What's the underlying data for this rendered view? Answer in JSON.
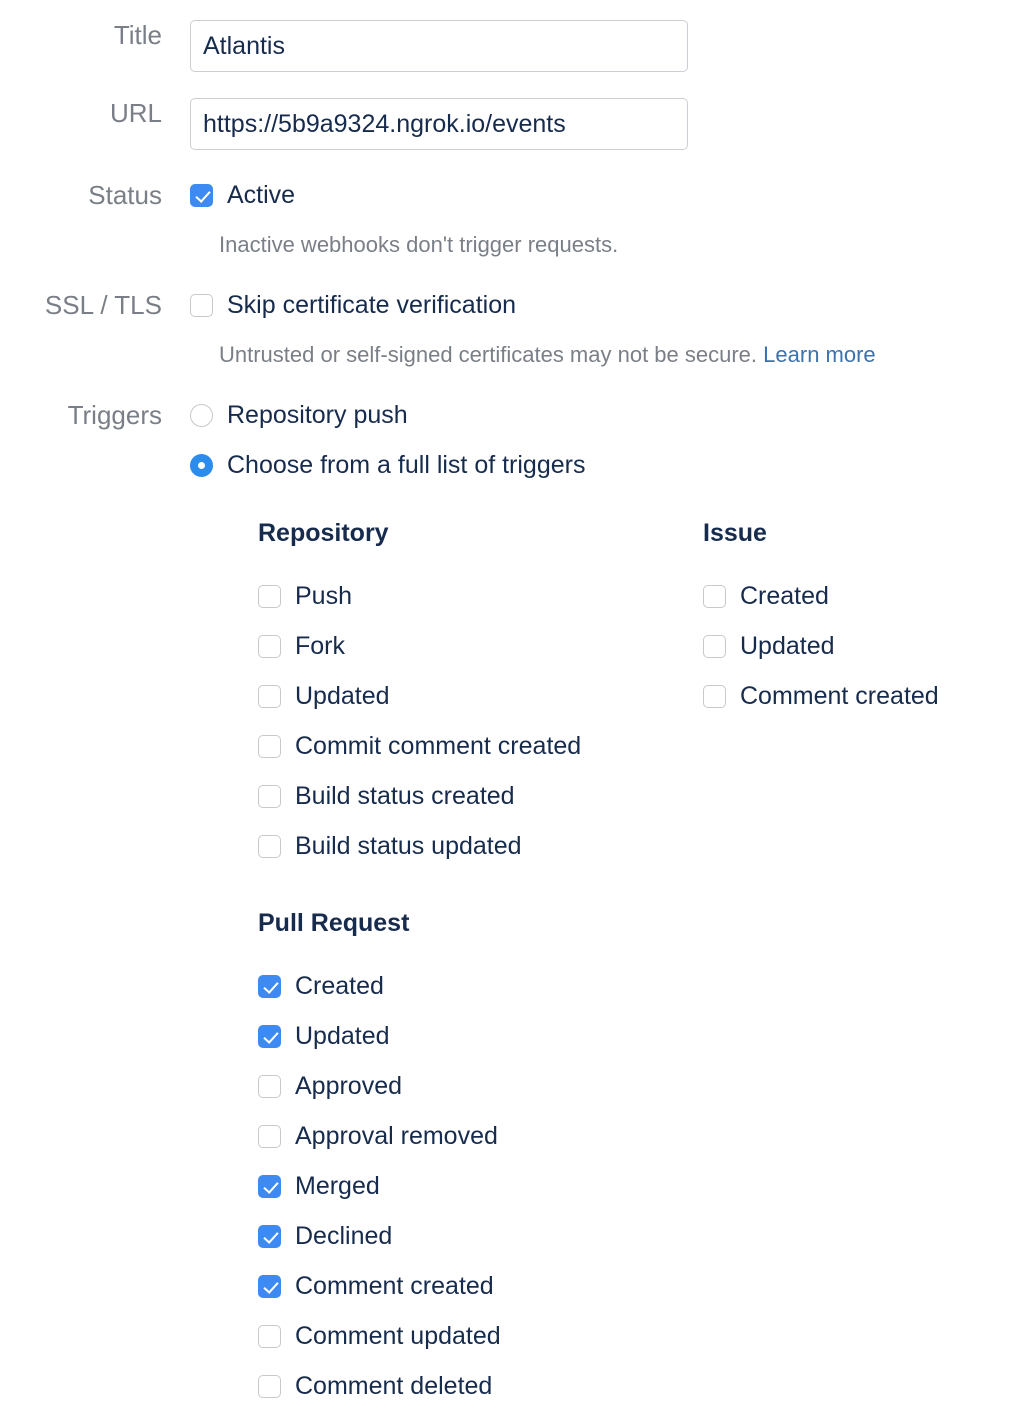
{
  "form": {
    "title": {
      "label": "Title",
      "value": "Atlantis",
      "placeholder": "Title"
    },
    "url": {
      "label": "URL",
      "value": "https://5b9a9324.ngrok.io/events",
      "placeholder": "URL"
    },
    "status": {
      "label": "Status",
      "active_label": "Active",
      "active_checked": true,
      "helper": "Inactive webhooks don't trigger requests."
    },
    "ssl": {
      "label": "SSL / TLS",
      "skip_label": "Skip certificate verification",
      "skip_checked": false,
      "helper": "Untrusted or self-signed certificates may not be secure.",
      "link_label": "Learn more"
    },
    "triggers": {
      "label": "Triggers",
      "options": [
        {
          "label": "Repository push",
          "selected": false
        },
        {
          "label": "Choose from a full list of triggers",
          "selected": true
        }
      ]
    }
  },
  "trigger_groups": {
    "repository": {
      "heading": "Repository",
      "items": [
        {
          "label": "Push",
          "checked": false
        },
        {
          "label": "Fork",
          "checked": false
        },
        {
          "label": "Updated",
          "checked": false
        },
        {
          "label": "Commit comment created",
          "checked": false
        },
        {
          "label": "Build status created",
          "checked": false
        },
        {
          "label": "Build status updated",
          "checked": false
        }
      ]
    },
    "issue": {
      "heading": "Issue",
      "items": [
        {
          "label": "Created",
          "checked": false
        },
        {
          "label": "Updated",
          "checked": false
        },
        {
          "label": "Comment created",
          "checked": false
        }
      ]
    },
    "pull_request": {
      "heading": "Pull Request",
      "items": [
        {
          "label": "Created",
          "checked": true
        },
        {
          "label": "Updated",
          "checked": true
        },
        {
          "label": "Approved",
          "checked": false
        },
        {
          "label": "Approval removed",
          "checked": false
        },
        {
          "label": "Merged",
          "checked": true
        },
        {
          "label": "Declined",
          "checked": true
        },
        {
          "label": "Comment created",
          "checked": true
        },
        {
          "label": "Comment updated",
          "checked": false
        },
        {
          "label": "Comment deleted",
          "checked": false
        }
      ]
    }
  },
  "colors": {
    "accent": "#3d8bf2",
    "radio_accent": "#2b8ceb",
    "link": "#3b73af",
    "label_gray": "#7a7f87",
    "text_dark": "#172b4d",
    "border_gray": "#ccced3"
  }
}
